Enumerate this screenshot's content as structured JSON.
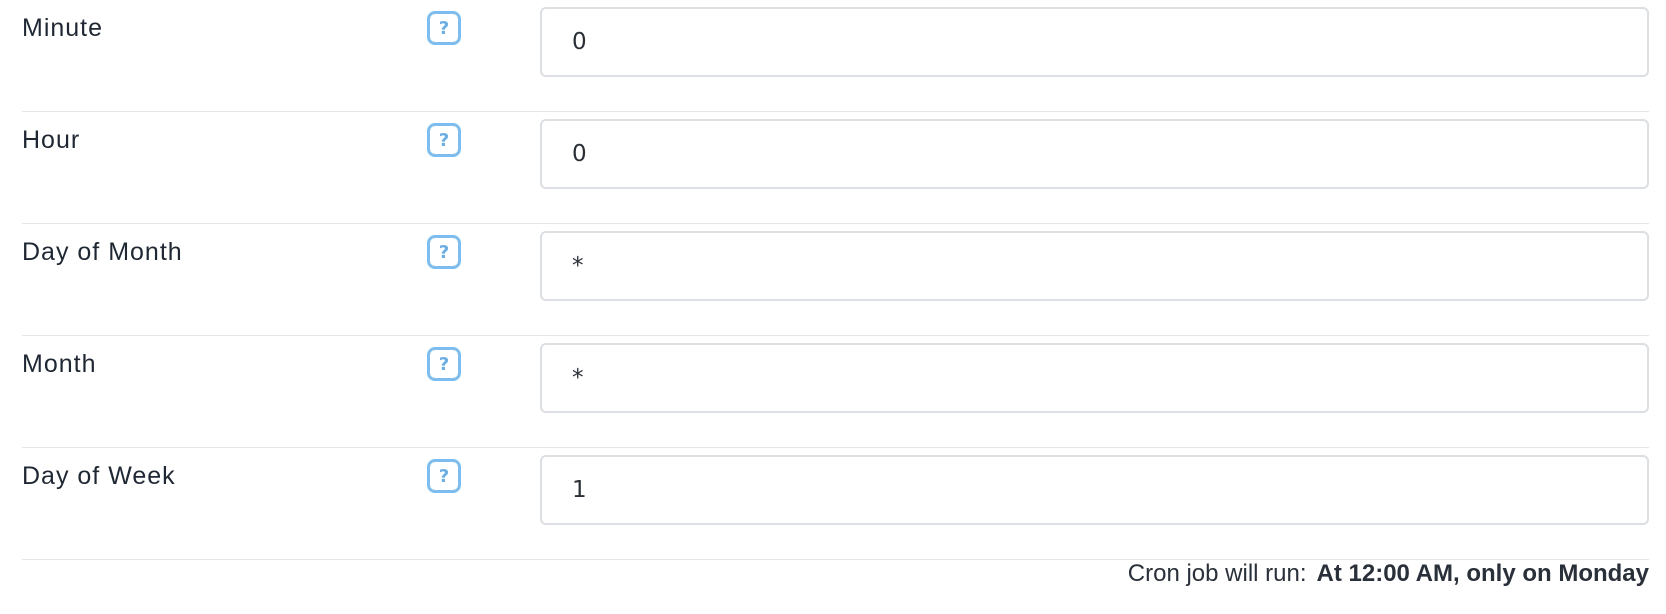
{
  "fields": [
    {
      "label": "Minute",
      "help_symbol": "?",
      "value": "0"
    },
    {
      "label": "Hour",
      "help_symbol": "?",
      "value": "0"
    },
    {
      "label": "Day of Month",
      "help_symbol": "?",
      "value": "*"
    },
    {
      "label": "Month",
      "help_symbol": "?",
      "value": "*"
    },
    {
      "label": "Day of Week",
      "help_symbol": "?",
      "value": "1"
    }
  ],
  "summary": {
    "prefix": "Cron job will run:",
    "value": "At 12:00 AM, only on Monday"
  },
  "colors": {
    "help_icon": "#7dbdf0",
    "text": "#1f2733",
    "border": "#dcdfe3",
    "divider": "#e3e6ea"
  },
  "icons": {
    "help": "question-mark-icon"
  }
}
